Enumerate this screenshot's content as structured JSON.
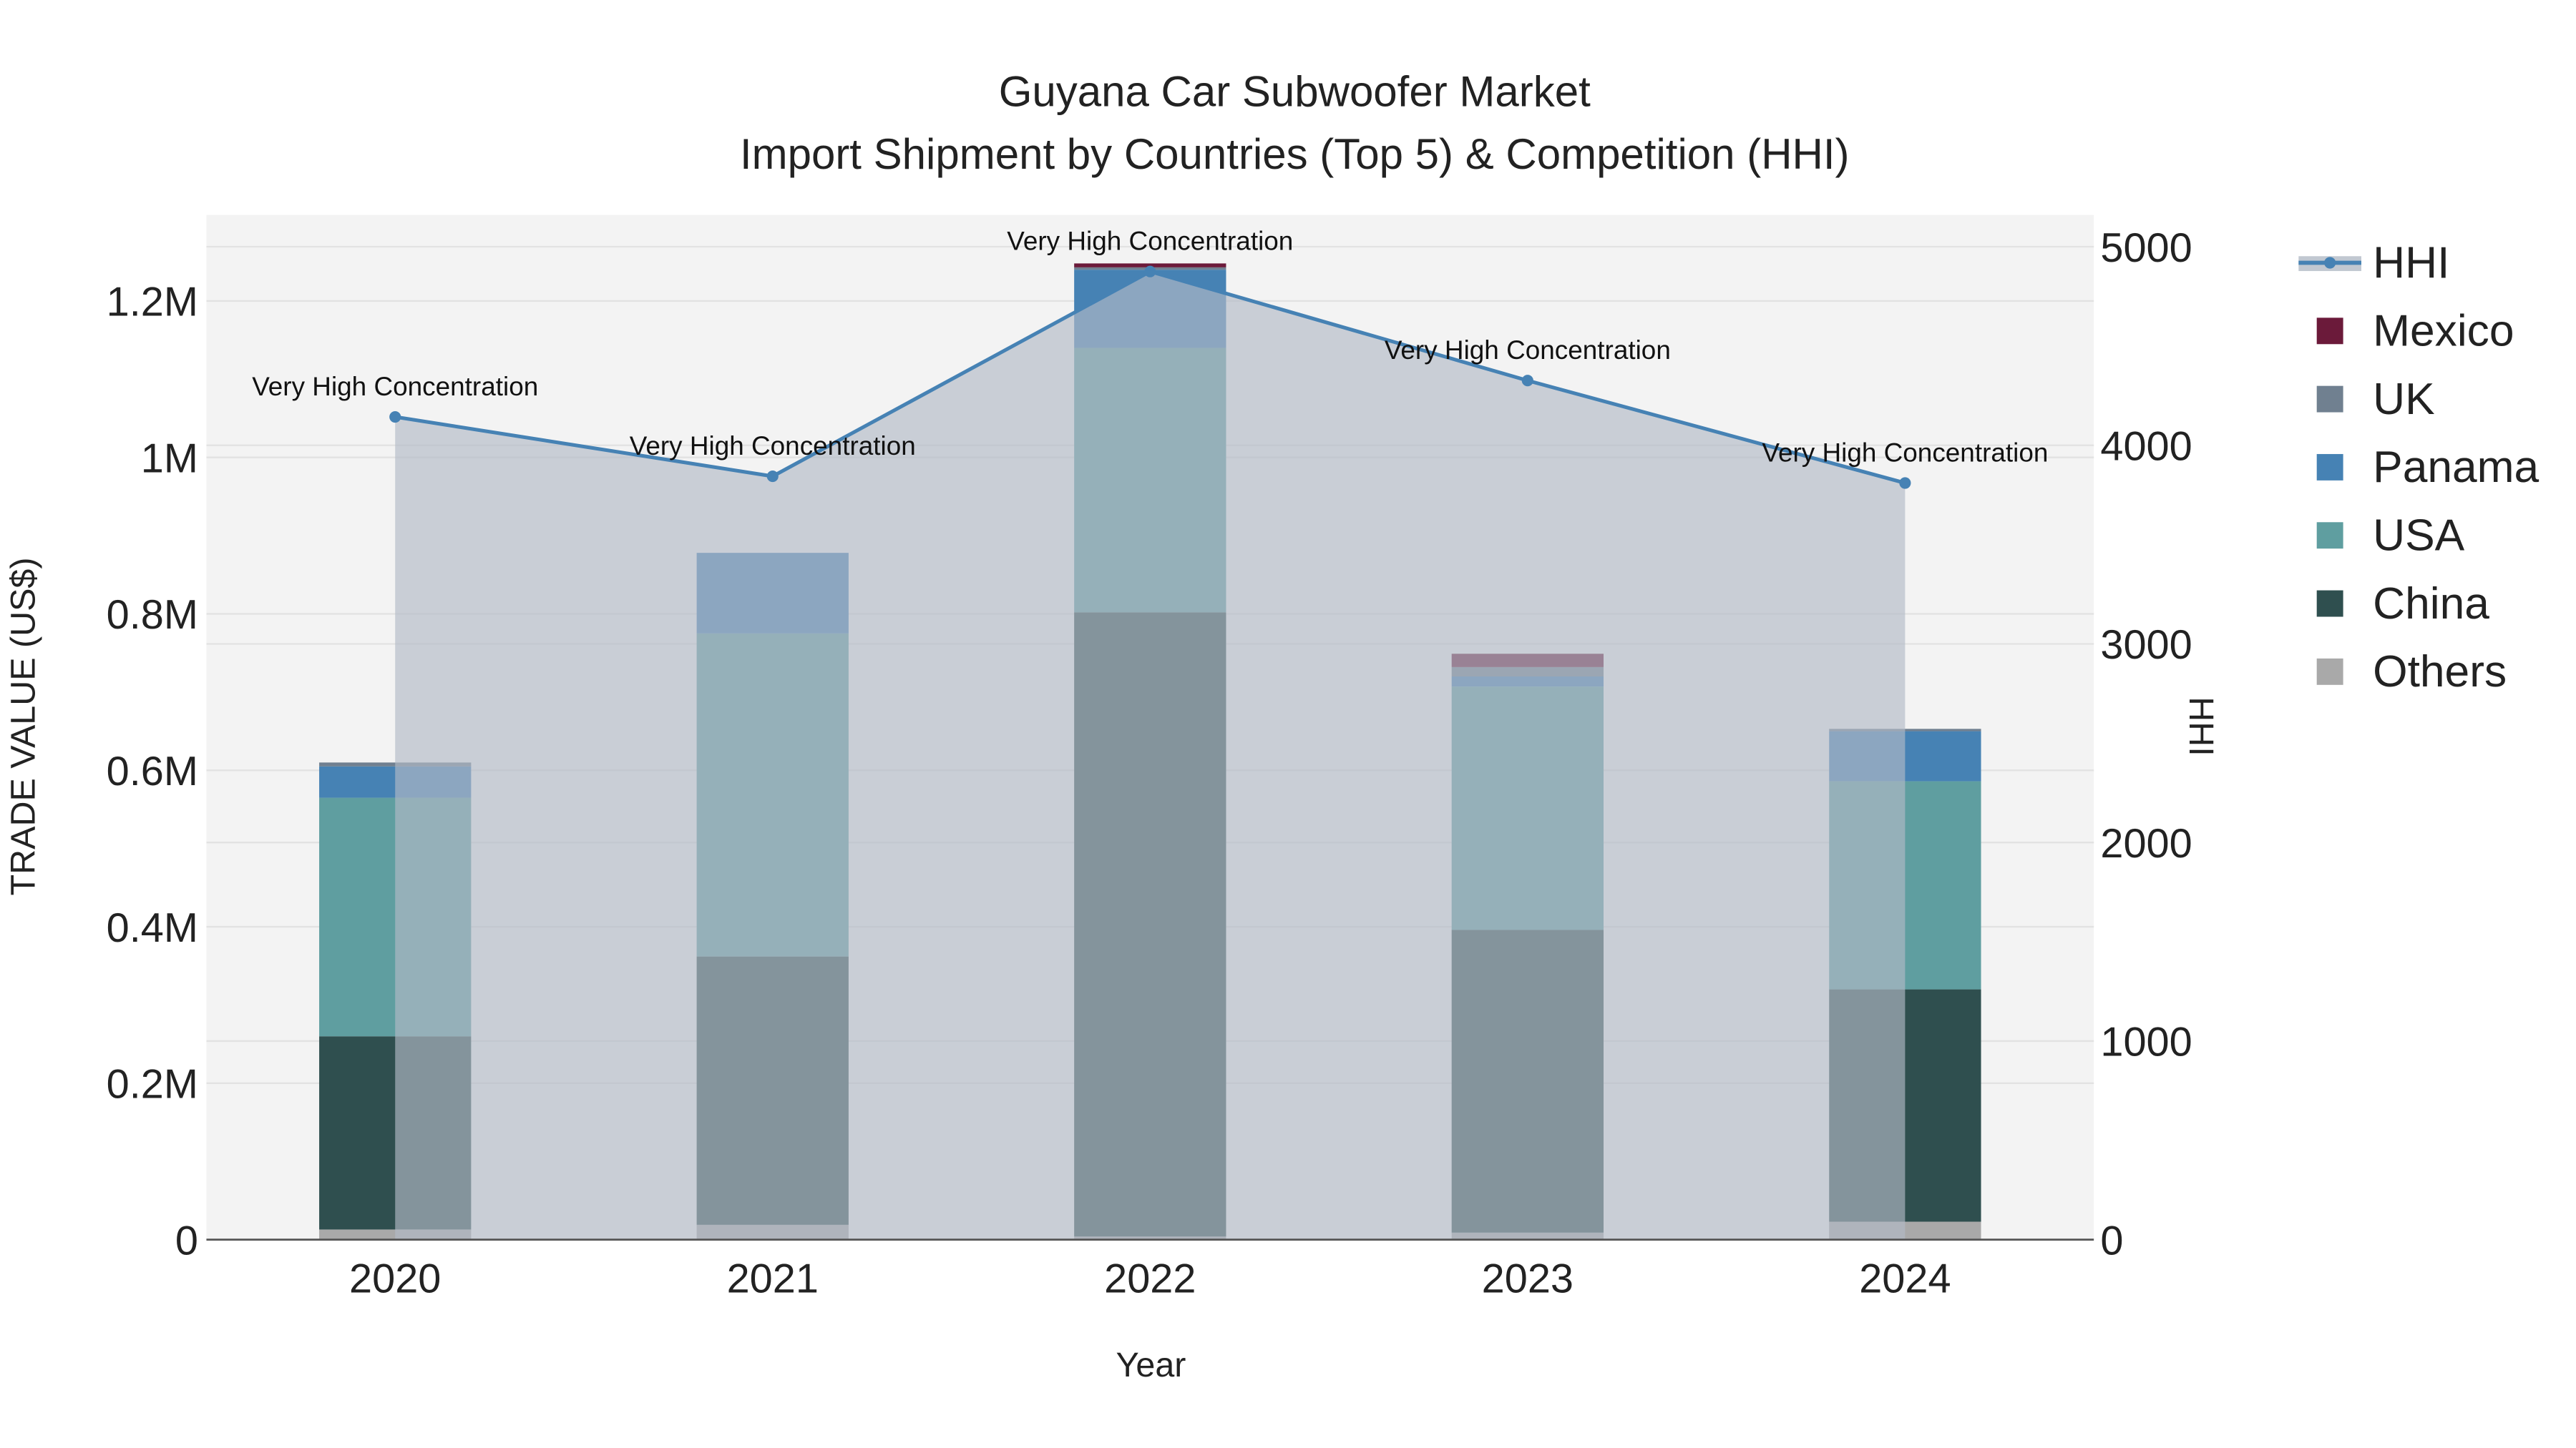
{
  "chart_data": {
    "type": "bar",
    "title": "Guyana Car Subwoofer Market",
    "subtitle": "Import Shipment by Countries (Top 5) & Competition (HHI)",
    "xlabel": "Year",
    "ylabel": "TRADE VALUE (US$)",
    "y2label": "HHI",
    "categories": [
      "2020",
      "2021",
      "2022",
      "2023",
      "2024"
    ],
    "ylim": [
      0,
      1310000
    ],
    "y2lim": [
      0,
      5160
    ],
    "yticks": [
      {
        "v": 0,
        "label": "0"
      },
      {
        "v": 200000,
        "label": "0.2M"
      },
      {
        "v": 400000,
        "label": "0.4M"
      },
      {
        "v": 600000,
        "label": "0.6M"
      },
      {
        "v": 800000,
        "label": "0.8M"
      },
      {
        "v": 1000000,
        "label": "1M"
      },
      {
        "v": 1200000,
        "label": "1.2M"
      }
    ],
    "y2ticks": [
      {
        "v": 0,
        "label": "0"
      },
      {
        "v": 1000,
        "label": "1000"
      },
      {
        "v": 2000,
        "label": "2000"
      },
      {
        "v": 3000,
        "label": "3000"
      },
      {
        "v": 4000,
        "label": "4000"
      },
      {
        "v": 5000,
        "label": "5000"
      }
    ],
    "series": [
      {
        "name": "Others",
        "color": "#a9a9a9",
        "values": [
          13000,
          19000,
          4000,
          9000,
          23000
        ]
      },
      {
        "name": "China",
        "color": "#2f4f4f",
        "values": [
          247000,
          343000,
          798000,
          387000,
          297000
        ]
      },
      {
        "name": "USA",
        "color": "#5f9ea0",
        "values": [
          305000,
          413000,
          338000,
          311000,
          266000
        ]
      },
      {
        "name": "Panama",
        "color": "#4682b4",
        "values": [
          40000,
          103000,
          100000,
          13000,
          64000
        ]
      },
      {
        "name": "UK",
        "color": "#708090",
        "values": [
          5000,
          0,
          3000,
          12000,
          3000
        ]
      },
      {
        "name": "Mexico",
        "color": "#6b1a3a",
        "values": [
          0,
          0,
          5000,
          17000,
          0
        ]
      }
    ],
    "hhi": {
      "name": "HHI",
      "color": "#4682b4",
      "values": [
        4143,
        3844,
        4875,
        4326,
        3810
      ],
      "annotations": [
        "Very High Concentration",
        "Very High Concentration",
        "Very High Concentration",
        "Very High Concentration",
        "Very High Concentration"
      ]
    },
    "legend": {
      "placement": "right",
      "items": [
        "HHI",
        "Mexico",
        "UK",
        "Panama",
        "USA",
        "China",
        "Others"
      ]
    }
  }
}
